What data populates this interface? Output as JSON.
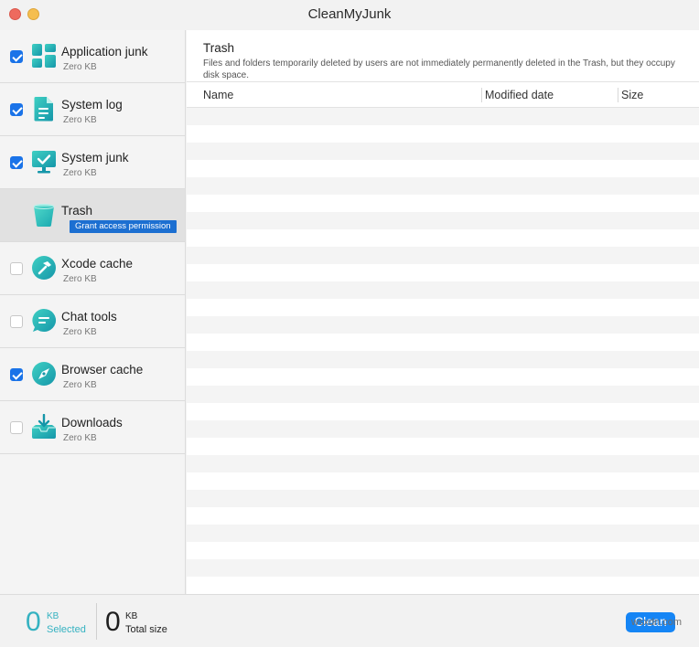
{
  "window": {
    "title": "CleanMyJunk"
  },
  "sidebar": {
    "items": [
      {
        "label": "Application junk",
        "size": "Zero KB",
        "checked": true,
        "icon": "app-grid-icon"
      },
      {
        "label": "System log",
        "size": "Zero KB",
        "checked": true,
        "icon": "document-icon"
      },
      {
        "label": "System junk",
        "size": "Zero KB",
        "checked": true,
        "icon": "monitor-check-icon"
      },
      {
        "label": "Trash",
        "badge": "Grant access permission",
        "selected": true,
        "icon": "trash-icon"
      },
      {
        "label": "Xcode cache",
        "size": "Zero KB",
        "checked": false,
        "icon": "hammer-icon"
      },
      {
        "label": "Chat tools",
        "size": "Zero KB",
        "checked": false,
        "icon": "chat-bubble-icon"
      },
      {
        "label": "Browser cache",
        "size": "Zero KB",
        "checked": true,
        "icon": "compass-icon"
      },
      {
        "label": "Downloads",
        "size": "Zero KB",
        "checked": false,
        "icon": "download-tray-icon"
      }
    ]
  },
  "content": {
    "title": "Trash",
    "description": "Files and folders temporarily deleted by users are not immediately permanently deleted in the Trash, but they occupy disk space.",
    "columns": [
      "Name",
      "Modified date",
      "Size"
    ]
  },
  "footer": {
    "selected": {
      "value": "0",
      "unit": "KB",
      "label": "Selected"
    },
    "total": {
      "value": "0",
      "unit": "KB",
      "label": "Total size"
    },
    "clean_label": "Clean"
  },
  "watermark": "wsxdn.com",
  "colors": {
    "accent": "#1585f5",
    "checkbox": "#1a73e8",
    "badge": "#1c6fd1",
    "selected_count": "#35b2c1",
    "icon_teal": "#20b7b0"
  }
}
